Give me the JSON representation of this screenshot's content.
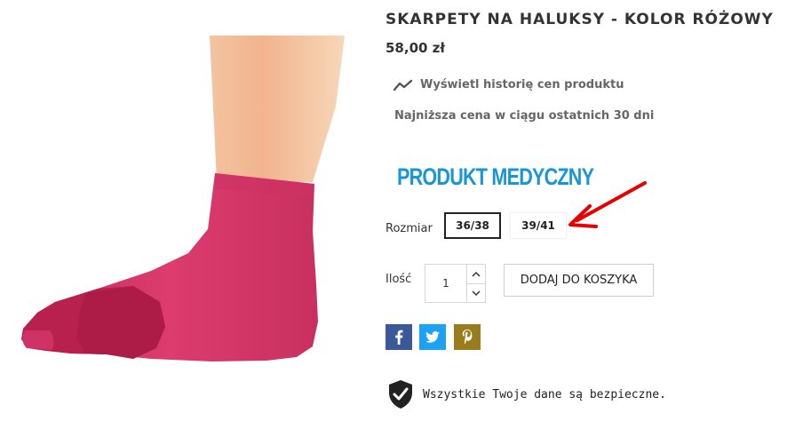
{
  "product": {
    "title": "SKARPETY NA HALUKSY - KOLOR RÓŻOWY",
    "price": "58,00 zł",
    "image_icon": "pink-toe-sock-photo",
    "sock_color": "#d8376a"
  },
  "price_history": {
    "link_label": "Wyświetl historię cen produktu",
    "lowest_label": "Najniższa cena w ciągu ostatnich 30 dni"
  },
  "badge": {
    "text": "PRODUKT MEDYCZNY",
    "color": "#1a96d8"
  },
  "size": {
    "label": "Rozmiar",
    "options": [
      "36/38",
      "39/41"
    ],
    "selected": "36/38"
  },
  "quantity": {
    "label": "Ilość",
    "value": "1"
  },
  "cart": {
    "add_label": "DODAJ DO KOSZYKA"
  },
  "share": {
    "facebook_color": "#3b5998",
    "twitter_color": "#1da1f2",
    "pinterest_color": "#9b7c1d"
  },
  "security": {
    "text": "Wszystkie Twoje dane są bezpieczne."
  },
  "annotation": {
    "arrow_color": "#e60000"
  }
}
